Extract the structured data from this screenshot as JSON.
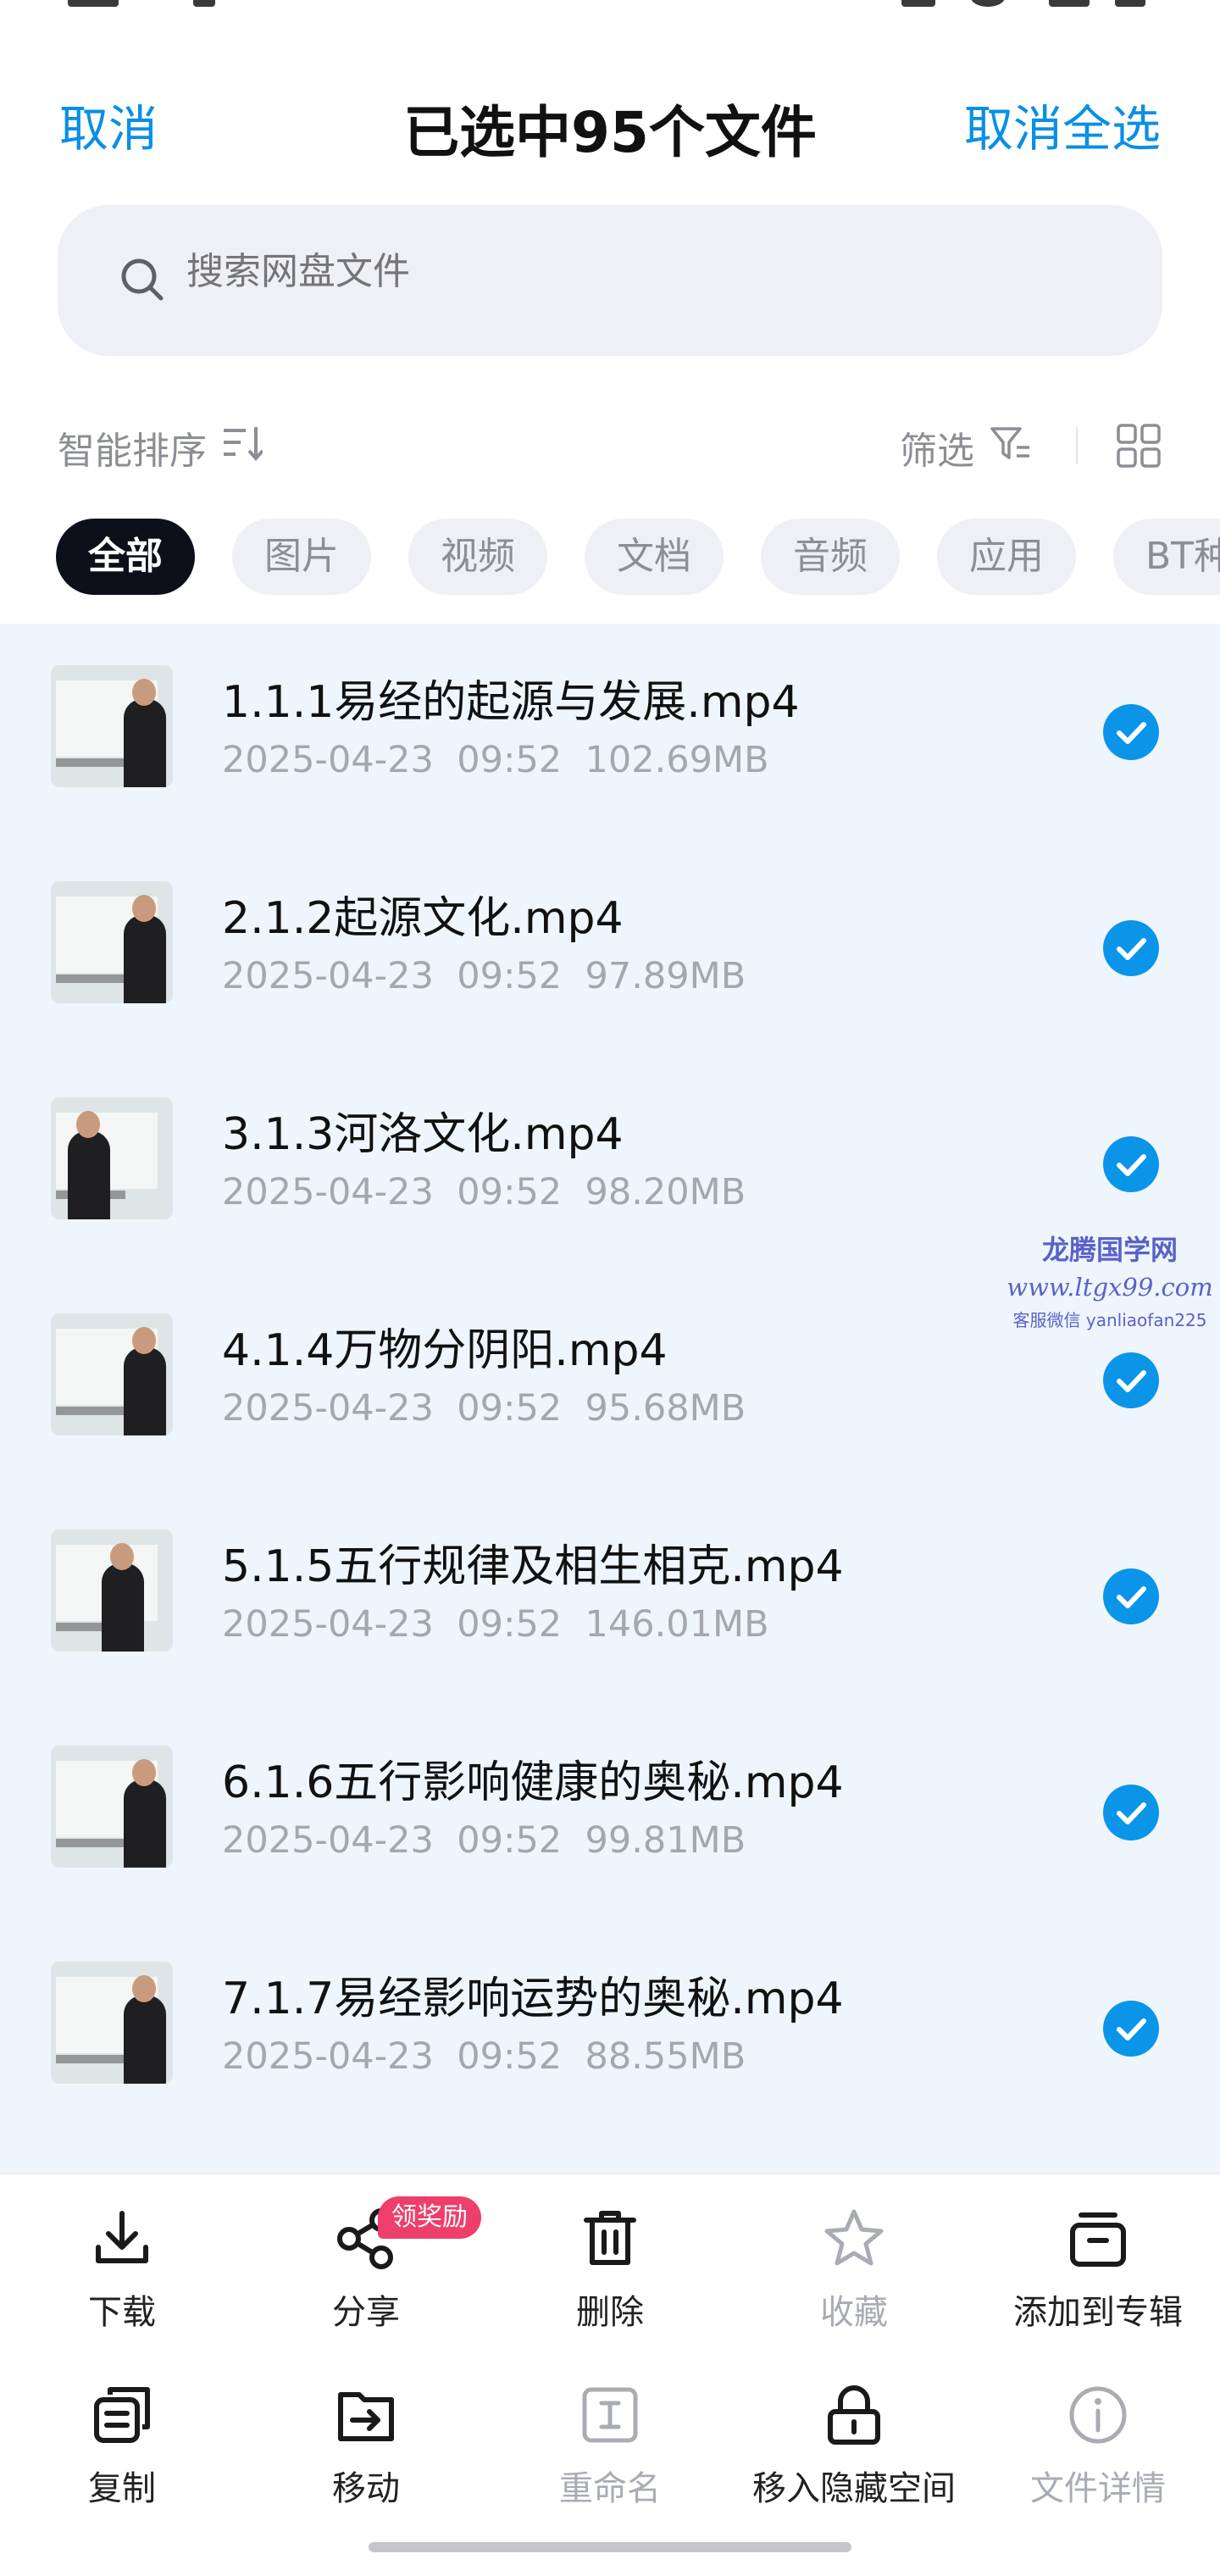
{
  "header": {
    "cancel": "取消",
    "title": "已选中95个文件",
    "deselect_all": "取消全选"
  },
  "search": {
    "placeholder": "搜索网盘文件"
  },
  "sort": {
    "label": "智能排序",
    "filter_label": "筛选"
  },
  "tabs": [
    "全部",
    "图片",
    "视频",
    "文档",
    "音频",
    "应用",
    "BT种"
  ],
  "active_tab": "全部",
  "files": [
    {
      "name": "1.1.1易经的起源与发展.mp4",
      "date": "2025-04-23",
      "time": "09:52",
      "size": "102.69MB",
      "selected": true
    },
    {
      "name": "2.1.2起源文化.mp4",
      "date": "2025-04-23",
      "time": "09:52",
      "size": "97.89MB",
      "selected": true
    },
    {
      "name": "3.1.3河洛文化.mp4",
      "date": "2025-04-23",
      "time": "09:52",
      "size": "98.20MB",
      "selected": true
    },
    {
      "name": "4.1.4万物分阴阳.mp4",
      "date": "2025-04-23",
      "time": "09:52",
      "size": "95.68MB",
      "selected": true
    },
    {
      "name": "5.1.5五行规律及相生相克.mp4",
      "date": "2025-04-23",
      "time": "09:52",
      "size": "146.01MB",
      "selected": true
    },
    {
      "name": "6.1.6五行影响健康的奥秘.mp4",
      "date": "2025-04-23",
      "time": "09:52",
      "size": "99.81MB",
      "selected": true
    },
    {
      "name": "7.1.7易经影响运势的奥秘.mp4",
      "date": "2025-04-23",
      "time": "09:52",
      "size": "88.55MB",
      "selected": true
    }
  ],
  "watermark": {
    "line1": "龙腾国学网",
    "line2": "www.ltgx99.com",
    "line3": "客服微信 yanliaofan225"
  },
  "toolbar": {
    "row1": [
      {
        "label": "下载",
        "icon": "download-icon",
        "enabled": true
      },
      {
        "label": "分享",
        "icon": "share-icon",
        "enabled": true
      },
      {
        "label": "删除",
        "icon": "trash-icon",
        "enabled": true
      },
      {
        "label": "收藏",
        "icon": "star-icon",
        "enabled": false
      },
      {
        "label": "添加到专辑",
        "icon": "album-icon",
        "enabled": true
      }
    ],
    "row2": [
      {
        "label": "复制",
        "icon": "copy-icon",
        "enabled": true
      },
      {
        "label": "移动",
        "icon": "move-icon",
        "enabled": true
      },
      {
        "label": "重命名",
        "icon": "rename-icon",
        "enabled": false
      },
      {
        "label": "移入隐藏空间",
        "icon": "lock-icon",
        "enabled": true
      },
      {
        "label": "文件详情",
        "icon": "info-icon",
        "enabled": false
      }
    ],
    "share_badge": "领奖励"
  },
  "colors": {
    "accent": "#0a8fe6",
    "check": "#0a95e8",
    "list_bg": "#eef5fc",
    "badge": "#ee3f6b",
    "active_tab_bg": "#0d0f1a"
  }
}
